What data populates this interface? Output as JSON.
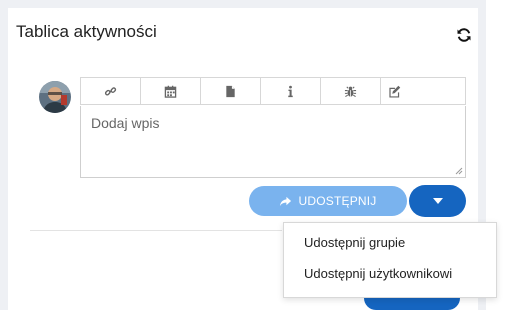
{
  "panel": {
    "title": "Tablica aktywności",
    "refresh_icon": "refresh-icon"
  },
  "toolbar": {
    "icons": [
      "link-icon",
      "calendar-icon",
      "file-icon",
      "info-icon",
      "bug-icon",
      "edit-icon"
    ]
  },
  "editor": {
    "placeholder": "Dodaj wpis",
    "value": ""
  },
  "share": {
    "label": "UDOSTĘPNIJ",
    "icon": "share-icon",
    "dropdown_icon": "caret-down-icon",
    "menu": [
      "Udostępnij grupie",
      "Udostępnij użytkownikowi"
    ]
  },
  "colors": {
    "primary": "#1565c0",
    "primary_light": "#7ab3ee"
  }
}
